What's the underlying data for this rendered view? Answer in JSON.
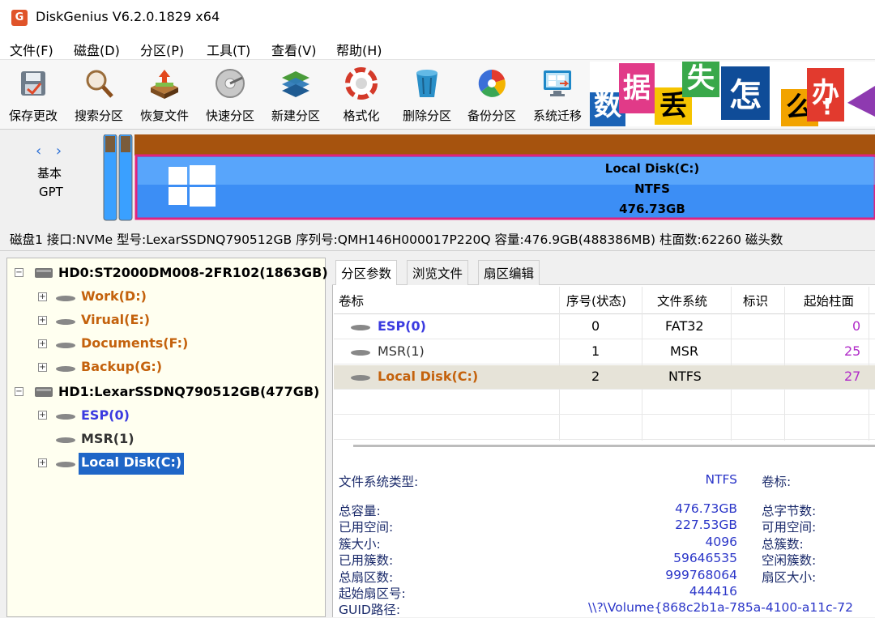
{
  "window": {
    "title": "DiskGenius V6.2.0.1829 x64",
    "icon": "app-logo-icon"
  },
  "menu": [
    "文件(F)",
    "磁盘(D)",
    "分区(P)",
    "工具(T)",
    "查看(V)",
    "帮助(H)"
  ],
  "toolbar": [
    {
      "label": "保存更改",
      "icon": "save-icon"
    },
    {
      "label": "搜索分区",
      "icon": "search-icon"
    },
    {
      "label": "恢复文件",
      "icon": "recover-icon"
    },
    {
      "label": "快速分区",
      "icon": "quick-partition-icon"
    },
    {
      "label": "新建分区",
      "icon": "new-partition-icon"
    },
    {
      "label": "格式化",
      "icon": "format-icon"
    },
    {
      "label": "删除分区",
      "icon": "delete-icon"
    },
    {
      "label": "备份分区",
      "icon": "backup-icon"
    },
    {
      "label": "系统迁移",
      "icon": "migrate-icon"
    }
  ],
  "banner": {
    "chars": [
      "数",
      "据",
      "丢",
      "失",
      "怎",
      "么",
      "办",
      "!"
    ]
  },
  "disk_map": {
    "nav": "‹ ›",
    "type": "基本",
    "scheme": "GPT",
    "partition_label": "Local Disk(C:)",
    "partition_fs": "NTFS",
    "partition_size": "476.73GB"
  },
  "disk_info": "磁盘1 接口:NVMe  型号:LexarSSDNQ790512GB  序列号:QMH146H000017P220Q  容量:476.9GB(488386MB)  柱面数:62260  磁头数",
  "tree": {
    "hd0": {
      "label": "HD0:ST2000DM008-2FR102(1863GB)",
      "children": [
        "Work(D:)",
        "Virual(E:)",
        "Documents(F:)",
        "Backup(G:)"
      ]
    },
    "hd1": {
      "label": "HD1:LexarSSDNQ790512GB(477GB)",
      "children": [
        "ESP(0)",
        "MSR(1)",
        "Local Disk(C:)"
      ]
    }
  },
  "tabs": [
    "分区参数",
    "浏览文件",
    "扇区编辑"
  ],
  "partition_table": {
    "headers": [
      "卷标",
      "序号(状态)",
      "文件系统",
      "标识",
      "起始柱面"
    ],
    "rows": [
      {
        "label": "ESP(0)",
        "index": "0",
        "fs": "FAT32",
        "flag": "",
        "start": "0"
      },
      {
        "label": "MSR(1)",
        "index": "1",
        "fs": "MSR",
        "flag": "",
        "start": "25"
      },
      {
        "label": "Local Disk(C:)",
        "index": "2",
        "fs": "NTFS",
        "flag": "",
        "start": "27"
      }
    ]
  },
  "details": {
    "fs_type_label": "文件系统类型:",
    "fs_type_value": "NTFS",
    "volume_label": "卷标:",
    "left": [
      {
        "k": "总容量:",
        "v": "476.73GB"
      },
      {
        "k": "已用空间:",
        "v": "227.53GB"
      },
      {
        "k": "簇大小:",
        "v": "4096"
      },
      {
        "k": "已用簇数:",
        "v": "59646535"
      },
      {
        "k": "总扇区数:",
        "v": "999768064"
      },
      {
        "k": "起始扇区号:",
        "v": "444416"
      }
    ],
    "right": [
      "总字节数:",
      "可用空间:",
      "总簇数:",
      "空闲簇数:",
      "扇区大小:"
    ],
    "guid_label": "GUID路径:",
    "guid_value": "\\\\?\\Volume{868c2b1a-785a-4100-a11c-72"
  }
}
